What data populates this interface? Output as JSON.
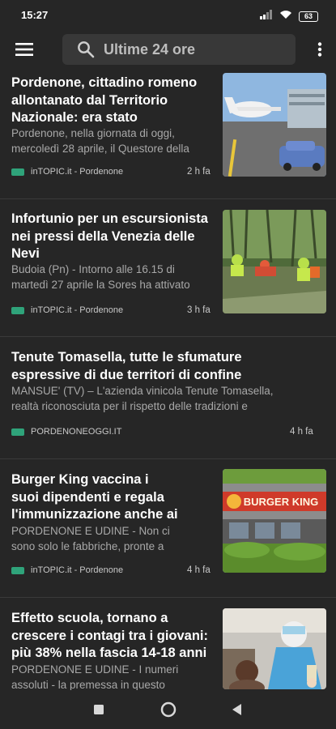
{
  "status": {
    "time": "15:27",
    "battery": "63"
  },
  "search": {
    "label": "Ultime 24 ore"
  },
  "articles": [
    {
      "title_lines": [
        "Pordenone, cittadino romeno",
        "allontanato dal Territorio",
        "Nazionale: era stato"
      ],
      "snippet_lines": [
        "Pordenone, nella giornata di oggi,",
        "mercoledì 28 aprile, il Questore della"
      ],
      "source": "inTOPIC.it - Pordenone",
      "time": "2 h fa"
    },
    {
      "title_lines": [
        "Infortunio per un escursionista",
        "nei pressi della Venezia delle",
        "Nevi"
      ],
      "snippet_lines": [
        "Budoia (Pn) - Intorno alle 16.15 di",
        "martedì 27 aprile la Sores ha attivato"
      ],
      "source": "inTOPIC.it - Pordenone",
      "time": "3 h fa"
    },
    {
      "title_lines": [
        "Tenute Tomasella, tutte le sfumature",
        "espressive di due territori di confine"
      ],
      "snippet_lines": [
        "MANSUE' (TV) – L'azienda vinicola Tenute Tomasella,",
        "realtà riconosciuta per il rispetto delle tradizioni e"
      ],
      "source": "PORDENONEOGGI.IT",
      "time": "4 h fa"
    },
    {
      "title_lines": [
        "Burger King vaccina i",
        "suoi dipendenti e regala",
        "l'immunizzazione anche ai"
      ],
      "snippet_lines": [
        "PORDENONE E UDINE - Non ci",
        "sono solo le fabbriche, pronte a"
      ],
      "source": "inTOPIC.it - Pordenone",
      "time": "4 h fa",
      "thumb_text": "BURGER KING"
    },
    {
      "title_lines": [
        "Effetto scuola, tornano a",
        "crescere i contagi tra i giovani:",
        "più 38% nella fascia 14-18 anni"
      ],
      "snippet_lines": [
        "PORDENONE E UDINE - I numeri",
        "assoluti - la premessa in questo"
      ]
    }
  ],
  "colors": {
    "background": "#262626",
    "search_bg": "#383838",
    "tag": "#2fa37a"
  }
}
